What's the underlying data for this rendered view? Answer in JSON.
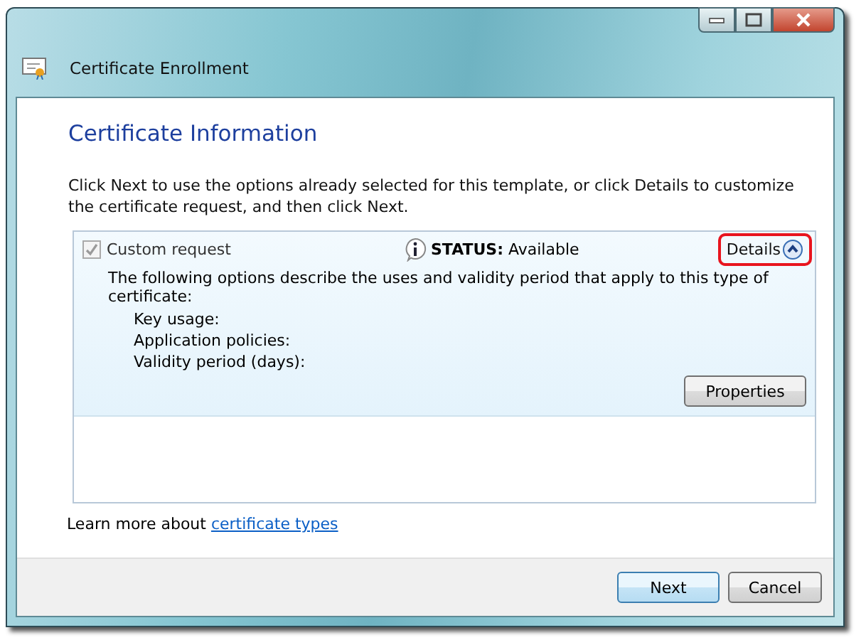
{
  "window": {
    "title": "Certificate Enrollment"
  },
  "heading": "Certificate Information",
  "description": "Click Next to use the options already selected for this template, or click Details to customize the certificate request, and then click Next.",
  "requests": [
    {
      "label": "Custom request",
      "checked": true,
      "disabled": true,
      "status_label": "STATUS:",
      "status": "Available",
      "details": "Details",
      "expanded": true,
      "highlighted": true,
      "summary": "The following options describe the uses and validity period that apply to this type of certificate:",
      "fields": [
        "Key usage:",
        "Application policies:",
        "Validity period (days):"
      ],
      "button": "Properties"
    }
  ],
  "learn_more": {
    "text": "Learn more about",
    "link": "certificate types"
  },
  "buttons": [
    {
      "label": "Next",
      "default": true
    },
    {
      "label": "Cancel",
      "default": false
    }
  ]
}
